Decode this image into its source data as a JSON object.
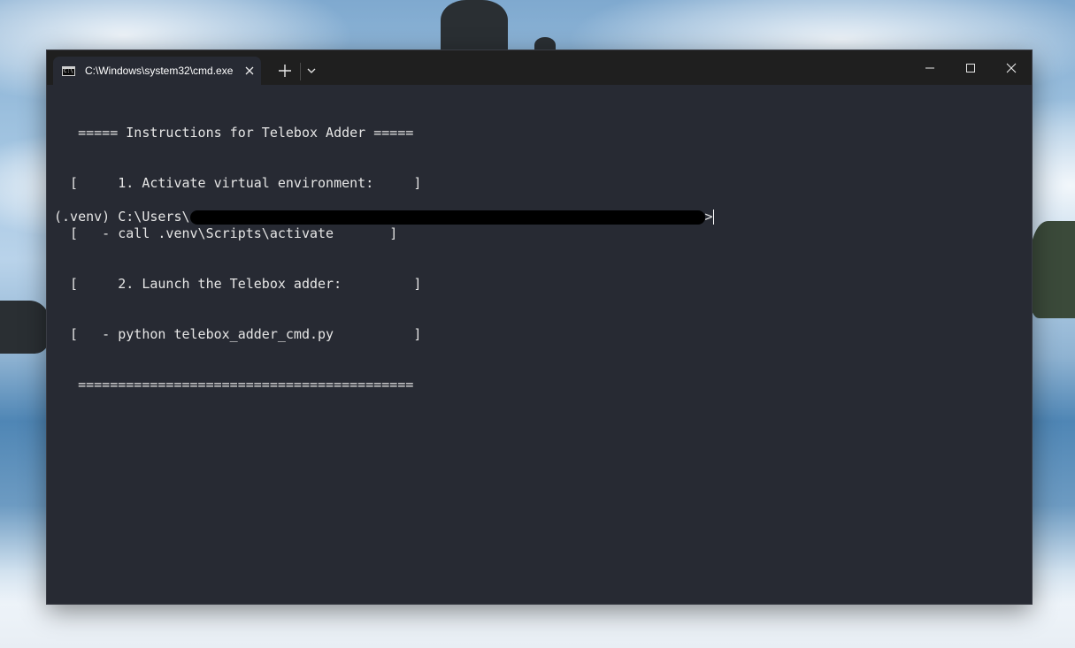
{
  "window": {
    "tab_title": "C:\\Windows\\system32\\cmd.exe",
    "tab_icon": "cmd-icon",
    "tab_icon_text": "C:\\",
    "close_tab_icon": "close-icon",
    "new_tab_label": "+",
    "dropdown_icon": "chevron-down-icon",
    "controls": [
      "minimize-icon",
      "maximize-icon",
      "close-icon"
    ]
  },
  "terminal": {
    "lines": [
      "   ===== Instructions for Telebox Adder =====",
      "  [     1. Activate virtual environment:     ]",
      "  [   - call .venv\\Scripts\\activate       ]",
      "  [     2. Launch the Telebox adder:         ]",
      "  [   - python telebox_adder_cmd.py          ]",
      "   =========================================="
    ],
    "prompt_prefix": "(.venv) C:\\Users\\",
    "prompt_suffix": ">"
  }
}
